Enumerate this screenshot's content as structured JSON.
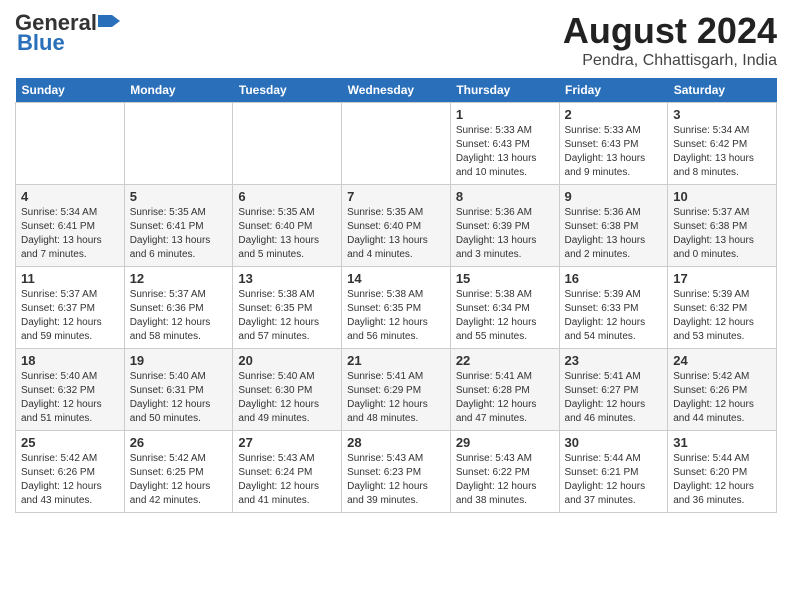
{
  "header": {
    "logo_general": "General",
    "logo_blue": "Blue",
    "month_year": "August 2024",
    "location": "Pendra, Chhattisgarh, India"
  },
  "days_of_week": [
    "Sunday",
    "Monday",
    "Tuesday",
    "Wednesday",
    "Thursday",
    "Friday",
    "Saturday"
  ],
  "weeks": [
    [
      {
        "day": "",
        "info": ""
      },
      {
        "day": "",
        "info": ""
      },
      {
        "day": "",
        "info": ""
      },
      {
        "day": "",
        "info": ""
      },
      {
        "day": "1",
        "info": "Sunrise: 5:33 AM\nSunset: 6:43 PM\nDaylight: 13 hours\nand 10 minutes."
      },
      {
        "day": "2",
        "info": "Sunrise: 5:33 AM\nSunset: 6:43 PM\nDaylight: 13 hours\nand 9 minutes."
      },
      {
        "day": "3",
        "info": "Sunrise: 5:34 AM\nSunset: 6:42 PM\nDaylight: 13 hours\nand 8 minutes."
      }
    ],
    [
      {
        "day": "4",
        "info": "Sunrise: 5:34 AM\nSunset: 6:41 PM\nDaylight: 13 hours\nand 7 minutes."
      },
      {
        "day": "5",
        "info": "Sunrise: 5:35 AM\nSunset: 6:41 PM\nDaylight: 13 hours\nand 6 minutes."
      },
      {
        "day": "6",
        "info": "Sunrise: 5:35 AM\nSunset: 6:40 PM\nDaylight: 13 hours\nand 5 minutes."
      },
      {
        "day": "7",
        "info": "Sunrise: 5:35 AM\nSunset: 6:40 PM\nDaylight: 13 hours\nand 4 minutes."
      },
      {
        "day": "8",
        "info": "Sunrise: 5:36 AM\nSunset: 6:39 PM\nDaylight: 13 hours\nand 3 minutes."
      },
      {
        "day": "9",
        "info": "Sunrise: 5:36 AM\nSunset: 6:38 PM\nDaylight: 13 hours\nand 2 minutes."
      },
      {
        "day": "10",
        "info": "Sunrise: 5:37 AM\nSunset: 6:38 PM\nDaylight: 13 hours\nand 0 minutes."
      }
    ],
    [
      {
        "day": "11",
        "info": "Sunrise: 5:37 AM\nSunset: 6:37 PM\nDaylight: 12 hours\nand 59 minutes."
      },
      {
        "day": "12",
        "info": "Sunrise: 5:37 AM\nSunset: 6:36 PM\nDaylight: 12 hours\nand 58 minutes."
      },
      {
        "day": "13",
        "info": "Sunrise: 5:38 AM\nSunset: 6:35 PM\nDaylight: 12 hours\nand 57 minutes."
      },
      {
        "day": "14",
        "info": "Sunrise: 5:38 AM\nSunset: 6:35 PM\nDaylight: 12 hours\nand 56 minutes."
      },
      {
        "day": "15",
        "info": "Sunrise: 5:38 AM\nSunset: 6:34 PM\nDaylight: 12 hours\nand 55 minutes."
      },
      {
        "day": "16",
        "info": "Sunrise: 5:39 AM\nSunset: 6:33 PM\nDaylight: 12 hours\nand 54 minutes."
      },
      {
        "day": "17",
        "info": "Sunrise: 5:39 AM\nSunset: 6:32 PM\nDaylight: 12 hours\nand 53 minutes."
      }
    ],
    [
      {
        "day": "18",
        "info": "Sunrise: 5:40 AM\nSunset: 6:32 PM\nDaylight: 12 hours\nand 51 minutes."
      },
      {
        "day": "19",
        "info": "Sunrise: 5:40 AM\nSunset: 6:31 PM\nDaylight: 12 hours\nand 50 minutes."
      },
      {
        "day": "20",
        "info": "Sunrise: 5:40 AM\nSunset: 6:30 PM\nDaylight: 12 hours\nand 49 minutes."
      },
      {
        "day": "21",
        "info": "Sunrise: 5:41 AM\nSunset: 6:29 PM\nDaylight: 12 hours\nand 48 minutes."
      },
      {
        "day": "22",
        "info": "Sunrise: 5:41 AM\nSunset: 6:28 PM\nDaylight: 12 hours\nand 47 minutes."
      },
      {
        "day": "23",
        "info": "Sunrise: 5:41 AM\nSunset: 6:27 PM\nDaylight: 12 hours\nand 46 minutes."
      },
      {
        "day": "24",
        "info": "Sunrise: 5:42 AM\nSunset: 6:26 PM\nDaylight: 12 hours\nand 44 minutes."
      }
    ],
    [
      {
        "day": "25",
        "info": "Sunrise: 5:42 AM\nSunset: 6:26 PM\nDaylight: 12 hours\nand 43 minutes."
      },
      {
        "day": "26",
        "info": "Sunrise: 5:42 AM\nSunset: 6:25 PM\nDaylight: 12 hours\nand 42 minutes."
      },
      {
        "day": "27",
        "info": "Sunrise: 5:43 AM\nSunset: 6:24 PM\nDaylight: 12 hours\nand 41 minutes."
      },
      {
        "day": "28",
        "info": "Sunrise: 5:43 AM\nSunset: 6:23 PM\nDaylight: 12 hours\nand 39 minutes."
      },
      {
        "day": "29",
        "info": "Sunrise: 5:43 AM\nSunset: 6:22 PM\nDaylight: 12 hours\nand 38 minutes."
      },
      {
        "day": "30",
        "info": "Sunrise: 5:44 AM\nSunset: 6:21 PM\nDaylight: 12 hours\nand 37 minutes."
      },
      {
        "day": "31",
        "info": "Sunrise: 5:44 AM\nSunset: 6:20 PM\nDaylight: 12 hours\nand 36 minutes."
      }
    ]
  ]
}
